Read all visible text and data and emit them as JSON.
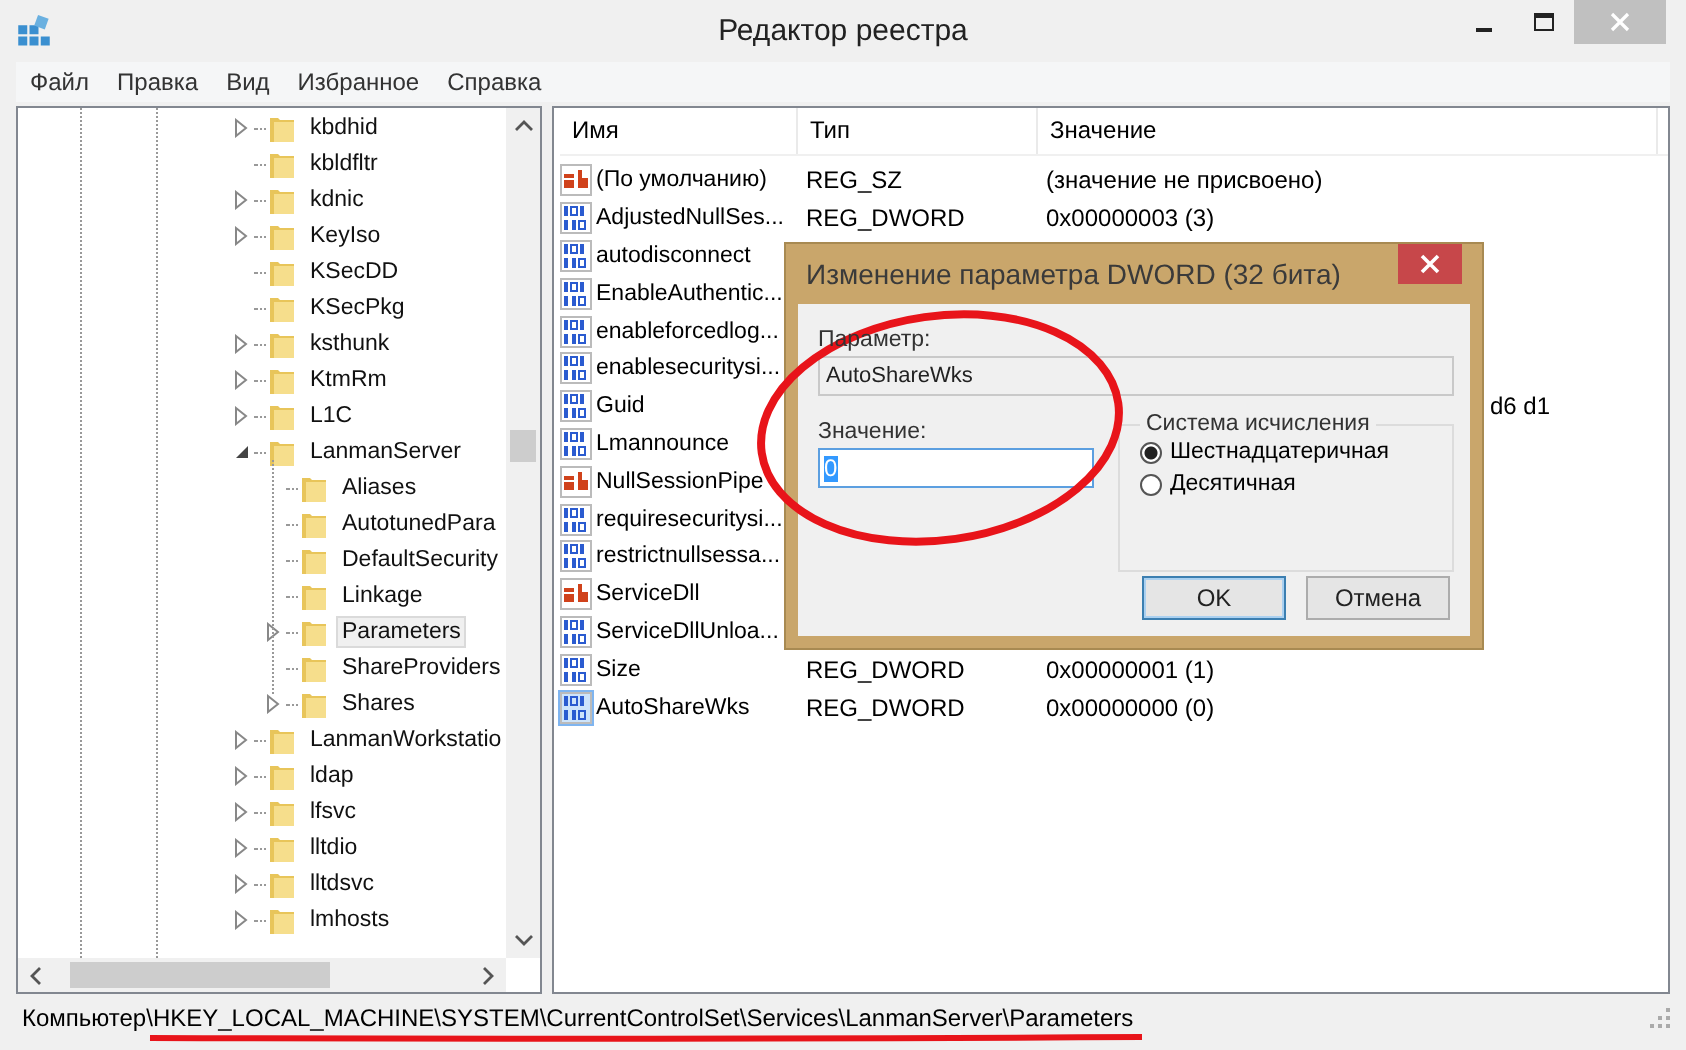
{
  "window": {
    "title": "Редактор реестра"
  },
  "menu": [
    "Файл",
    "Правка",
    "Вид",
    "Избранное",
    "Справка"
  ],
  "tree": [
    {
      "name": "kbdhid",
      "expandable": true,
      "expanded": false,
      "selected": false
    },
    {
      "name": "kbldfltr",
      "expandable": false,
      "selected": false
    },
    {
      "name": "kdnic",
      "expandable": true,
      "expanded": false,
      "selected": false
    },
    {
      "name": "KeyIso",
      "expandable": true,
      "expanded": false,
      "selected": false
    },
    {
      "name": "KSecDD",
      "expandable": false,
      "selected": false
    },
    {
      "name": "KSecPkg",
      "expandable": false,
      "selected": false
    },
    {
      "name": "ksthunk",
      "expandable": true,
      "expanded": false,
      "selected": false
    },
    {
      "name": "KtmRm",
      "expandable": true,
      "expanded": false,
      "selected": false
    },
    {
      "name": "L1C",
      "expandable": true,
      "expanded": false,
      "selected": false
    },
    {
      "name": "LanmanServer",
      "expandable": true,
      "expanded": true,
      "selected": false,
      "children": [
        {
          "name": "Aliases",
          "expandable": false,
          "selected": false
        },
        {
          "name": "AutotunedPara",
          "expandable": false,
          "selected": false
        },
        {
          "name": "DefaultSecurity",
          "expandable": false,
          "selected": false
        },
        {
          "name": "Linkage",
          "expandable": false,
          "selected": false
        },
        {
          "name": "Parameters",
          "expandable": true,
          "expanded": false,
          "selected": true
        },
        {
          "name": "ShareProviders",
          "expandable": false,
          "selected": false
        },
        {
          "name": "Shares",
          "expandable": true,
          "expanded": false,
          "selected": false
        }
      ]
    },
    {
      "name": "LanmanWorkstatio",
      "expandable": true,
      "expanded": false,
      "selected": false
    },
    {
      "name": "ldap",
      "expandable": true,
      "expanded": false,
      "selected": false
    },
    {
      "name": "lfsvc",
      "expandable": true,
      "expanded": false,
      "selected": false
    },
    {
      "name": "lltdio",
      "expandable": true,
      "expanded": false,
      "selected": false
    },
    {
      "name": "lltdsvc",
      "expandable": true,
      "expanded": false,
      "selected": false
    },
    {
      "name": "lmhosts",
      "expandable": true,
      "expanded": false,
      "selected": false
    }
  ],
  "table": {
    "columns": [
      "Имя",
      "Тип",
      "Значение"
    ],
    "rows": [
      {
        "kind": "string",
        "name": "(По умолчанию)",
        "type": "REG_SZ",
        "value": "(значение не присвоено)",
        "selected": false
      },
      {
        "kind": "dword",
        "name": "AdjustedNullSes...",
        "type": "REG_DWORD",
        "value": "0x00000003 (3)",
        "selected": false
      },
      {
        "kind": "dword",
        "name": "autodisconnect",
        "selected": false
      },
      {
        "kind": "dword",
        "name": "EnableAuthentic...",
        "selected": false
      },
      {
        "kind": "dword",
        "name": "enableforcedlog...",
        "selected": false
      },
      {
        "kind": "dword",
        "name": "enablesecuritysi...",
        "selected": false
      },
      {
        "kind": "dword",
        "name": "Guid",
        "value_tail": "d6 d1",
        "selected": false
      },
      {
        "kind": "dword",
        "name": "Lmannounce",
        "selected": false
      },
      {
        "kind": "string",
        "name": "NullSessionPipe",
        "selected": false
      },
      {
        "kind": "dword",
        "name": "requiresecuritysi...",
        "selected": false
      },
      {
        "kind": "dword",
        "name": "restrictnullsessa...",
        "selected": false
      },
      {
        "kind": "string",
        "name": "ServiceDll",
        "selected": false
      },
      {
        "kind": "dword",
        "name": "ServiceDllUnloa...",
        "selected": false
      },
      {
        "kind": "dword",
        "name": "Size",
        "type": "REG_DWORD",
        "value": "0x00000001 (1)",
        "selected": false
      },
      {
        "kind": "dword",
        "name": "AutoShareWks",
        "type": "REG_DWORD",
        "value": "0x00000000 (0)",
        "selected": true
      }
    ]
  },
  "dialog": {
    "title": "Изменение параметра DWORD (32 бита)",
    "param_label": "Параметр:",
    "param_value": "AutoShareWks",
    "value_label": "Значение:",
    "value": "0",
    "base_group": "Система исчисления",
    "bases": [
      {
        "label": "Шестнадцатеричная",
        "selected": true
      },
      {
        "label": "Десятичная",
        "selected": false
      }
    ],
    "buttons": [
      {
        "label": "OK",
        "default": true
      },
      {
        "label": "Отмена",
        "default": false
      }
    ]
  },
  "status_bar": {
    "prefix": "Компьютер\\",
    "path": "HKEY_LOCAL_MACHINE\\SYSTEM\\CurrentControlSet\\Services\\LanmanServer\\Parameters"
  }
}
